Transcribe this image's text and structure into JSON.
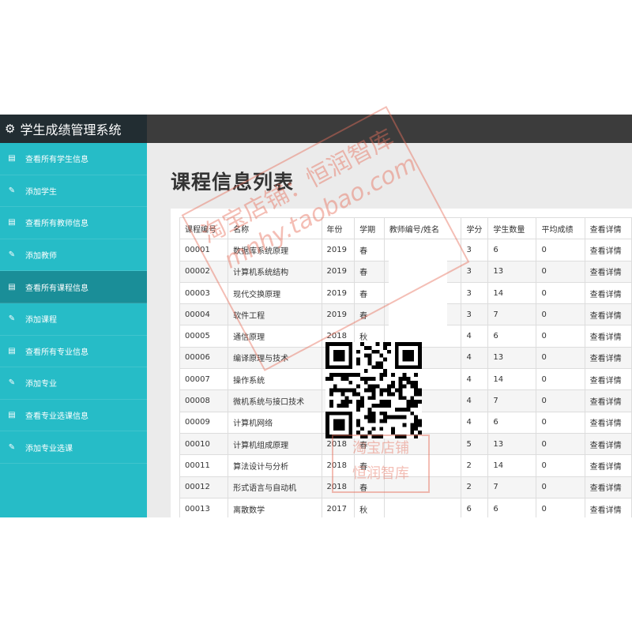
{
  "app": {
    "title": "学生成绩管理系统"
  },
  "sidebar": {
    "items": [
      {
        "label": "查看所有学生信息",
        "icon": "list-icon"
      },
      {
        "label": "添加学生",
        "icon": "edit-icon"
      },
      {
        "label": "查看所有教师信息",
        "icon": "list-icon"
      },
      {
        "label": "添加教师",
        "icon": "edit-icon"
      },
      {
        "label": "查看所有课程信息",
        "icon": "list-icon",
        "active": true
      },
      {
        "label": "添加课程",
        "icon": "edit-icon"
      },
      {
        "label": "查看所有专业信息",
        "icon": "list-icon"
      },
      {
        "label": "添加专业",
        "icon": "edit-icon"
      },
      {
        "label": "查看专业选课信息",
        "icon": "list-icon"
      },
      {
        "label": "添加专业选课",
        "icon": "edit-icon"
      }
    ]
  },
  "main": {
    "title": "课程信息列表",
    "table": {
      "headers": [
        "课程编号",
        "名称",
        "年份",
        "学期",
        "教师编号/姓名",
        "学分",
        "学生数量",
        "平均成绩",
        "查看详情"
      ],
      "rows": [
        [
          "00001",
          "数据库系统原理",
          "2019",
          "春",
          "",
          "3",
          "6",
          "0",
          "查看详情"
        ],
        [
          "00002",
          "计算机系统结构",
          "2019",
          "春",
          "",
          "3",
          "13",
          "0",
          "查看详情"
        ],
        [
          "00003",
          "现代交换原理",
          "2019",
          "春",
          "",
          "3",
          "14",
          "0",
          "查看详情"
        ],
        [
          "00004",
          "软件工程",
          "2019",
          "春",
          "",
          "3",
          "7",
          "0",
          "查看详情"
        ],
        [
          "00005",
          "通信原理",
          "2018",
          "秋",
          "",
          "4",
          "6",
          "0",
          "查看详情"
        ],
        [
          "00006",
          "编译原理与技术",
          "",
          "",
          "",
          "4",
          "13",
          "0",
          "查看详情"
        ],
        [
          "00007",
          "操作系统",
          "",
          "",
          "",
          "4",
          "14",
          "0",
          "查看详情"
        ],
        [
          "00008",
          "微机系统与接口技术",
          "",
          "",
          "",
          "4",
          "7",
          "0",
          "查看详情"
        ],
        [
          "00009",
          "计算机网络",
          "",
          "",
          "",
          "4",
          "6",
          "0",
          "查看详情"
        ],
        [
          "00010",
          "计算机组成原理",
          "2018",
          "春",
          "",
          "5",
          "13",
          "0",
          "查看详情"
        ],
        [
          "00011",
          "算法设计与分析",
          "2018",
          "春",
          "",
          "2",
          "14",
          "0",
          "查看详情"
        ],
        [
          "00012",
          "形式语言与自动机",
          "2018",
          "春",
          "",
          "2",
          "7",
          "0",
          "查看详情"
        ],
        [
          "00013",
          "离散数学",
          "2017",
          "秋",
          "",
          "6",
          "6",
          "0",
          "查看详情"
        ]
      ]
    }
  },
  "watermark": {
    "line1": "淘宝店铺：恒润智库",
    "line2": "mnhy.taobao.com",
    "stamp1": "淘宝店铺",
    "stamp2": "恒润智库"
  },
  "colors": {
    "sidebar_bg": "#26bcc7",
    "sidebar_active": "#1a8e98",
    "brand_bg": "#222d32",
    "topbar_bg": "#3c3c3c"
  }
}
